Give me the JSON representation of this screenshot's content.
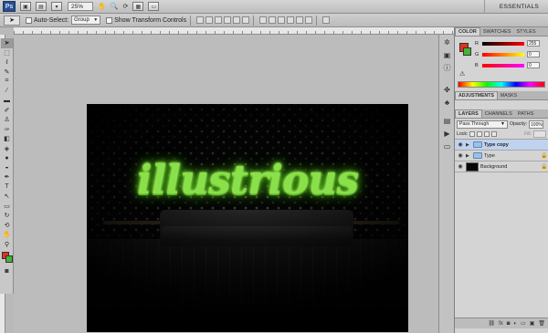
{
  "app": {
    "logo": "Ps",
    "zoom": "25%",
    "workspace": "ESSENTIALS",
    "icons": [
      "bridge-icon",
      "minibridge-icon",
      "hand-icon",
      "zoom-tool-icon",
      "rotate-view-icon",
      "arrange-docs-icon",
      "screen-mode-icon"
    ]
  },
  "options_bar": {
    "auto_select_label": "Auto-Select:",
    "auto_select_value": "Group",
    "show_transform_label": "Show Transform Controls"
  },
  "document": {
    "text": "illustrious"
  },
  "color_panel": {
    "tabs": [
      "COLOR",
      "SWATCHES",
      "STYLES"
    ],
    "channels": [
      {
        "label": "R",
        "value": "255"
      },
      {
        "label": "G",
        "value": "0"
      },
      {
        "label": "B",
        "value": "0"
      }
    ],
    "foreground": "#e8301d",
    "background": "#48b23a"
  },
  "adjustments_panel": {
    "tabs": [
      "ADJUSTMENTS",
      "MASKS"
    ]
  },
  "layers_panel": {
    "tabs": [
      "LAYERS",
      "CHANNELS",
      "PATHS"
    ],
    "blend_mode": "Pass Through",
    "opacity_label": "Opacity:",
    "opacity": "100%",
    "lock_label": "Lock:",
    "fill_label": "Fill:",
    "layers": [
      {
        "name": "Type copy",
        "kind": "group",
        "selected": true,
        "locked": false
      },
      {
        "name": "Type",
        "kind": "group",
        "selected": false,
        "locked": true
      },
      {
        "name": "Background",
        "kind": "image",
        "selected": false,
        "locked": true
      }
    ]
  }
}
